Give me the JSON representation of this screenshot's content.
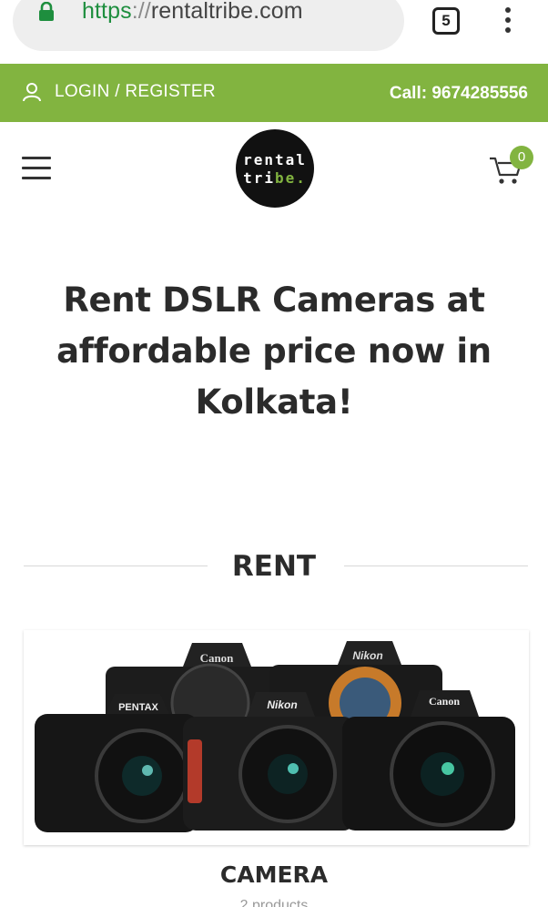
{
  "browser": {
    "url_scheme": "https",
    "url_sep": "://",
    "url_host": "rentaltribe.com",
    "tab_count": "5",
    "lock_icon": "lock-icon",
    "menu_icon": "kebab-menu-icon",
    "scheme_color": "#1e8e3e"
  },
  "topbar": {
    "login_label": "LOGIN / REGISTER",
    "call_label": "Call: 9674285556",
    "user_icon": "user-icon",
    "background": "#82b440"
  },
  "header": {
    "logo_line1": "rental",
    "logo_line2_a": "tri",
    "logo_line2_b": "be.",
    "cart_count": "0",
    "menu_icon": "hamburger-icon",
    "cart_icon": "cart-icon",
    "accent": "#82b440"
  },
  "hero": {
    "title": "Rent DSLR Cameras at affordable price now in Kolkata!"
  },
  "section": {
    "title": "RENT"
  },
  "products": [
    {
      "title": "CAMERA",
      "subtitle": "2 products",
      "image_icon": "cameras-image",
      "brands": [
        "Canon",
        "Nikon",
        "PENTAX",
        "Nikon",
        "Canon"
      ]
    }
  ]
}
